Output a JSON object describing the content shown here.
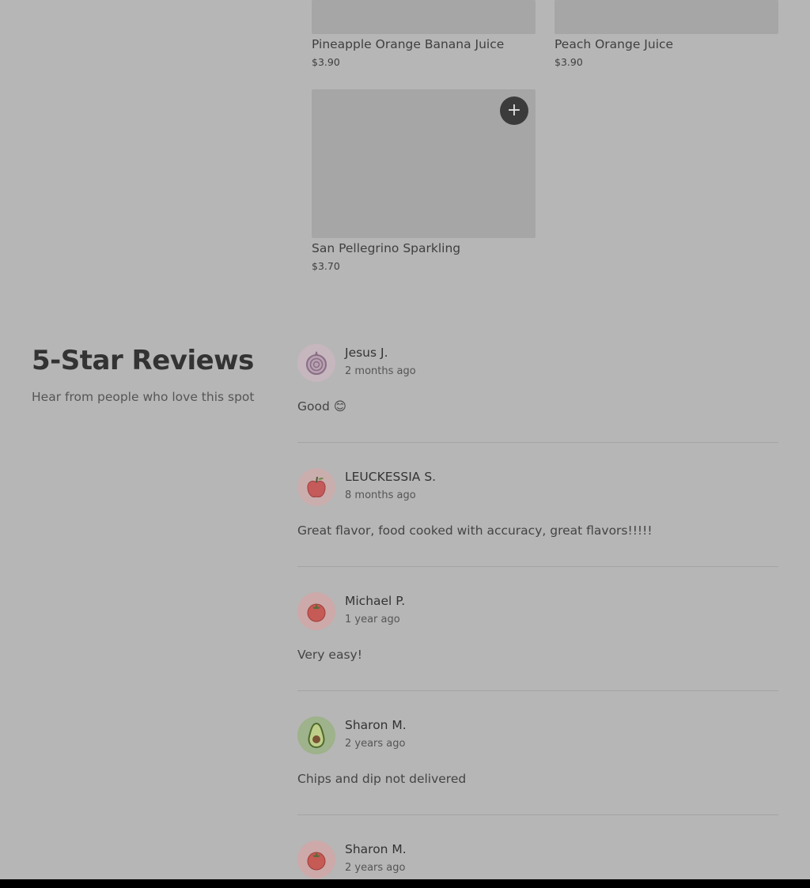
{
  "products": [
    {
      "name": "Pineapple Orange Banana Juice",
      "price": "$3.90"
    },
    {
      "name": "Peach Orange Juice",
      "price": "$3.90"
    },
    {
      "name": "San Pellegrino Sparkling",
      "price": "$3.70",
      "add_label": "+"
    }
  ],
  "reviews_section": {
    "title": "5-Star Reviews",
    "subtitle": "Hear from people who love this spot"
  },
  "reviews": [
    {
      "name": "Jesus J.",
      "date": "2 months ago",
      "text": "Good 😊",
      "avatar_icon": "onion-icon"
    },
    {
      "name": "LEUCKESSIA S.",
      "date": "8 months ago",
      "text": "Great flavor, food cooked with accuracy, great flavors!!!!!",
      "avatar_icon": "apple-icon"
    },
    {
      "name": "Michael P.",
      "date": "1 year ago",
      "text": "Very easy!",
      "avatar_icon": "tomato-icon"
    },
    {
      "name": "Sharon M.",
      "date": "2 years ago",
      "text": "Chips and dip not delivered",
      "avatar_icon": "avocado-icon"
    },
    {
      "name": "Sharon M.",
      "date": "2 years ago",
      "text": "",
      "avatar_icon": "tomato-icon"
    }
  ],
  "colors": {
    "overlay_bg": "#b6b6b6",
    "image_placeholder": "#a6a6a6",
    "button_bg": "#3b3b3b"
  }
}
